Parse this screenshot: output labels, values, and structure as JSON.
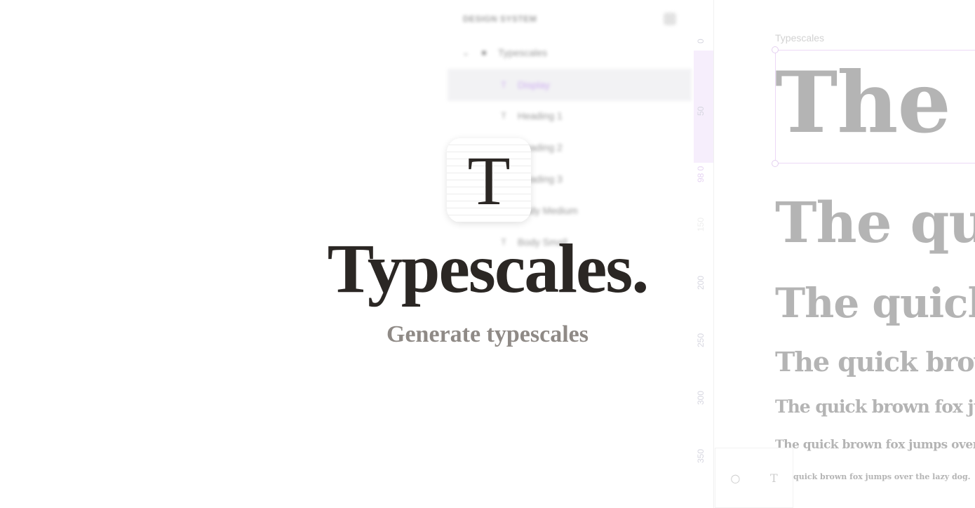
{
  "sidebar": {
    "title": "DESIGN SYSTEM",
    "items": [
      {
        "label": "Typescales",
        "icon": "frame-icon"
      },
      {
        "label": "Display",
        "icon": "text-icon",
        "selected": true
      },
      {
        "label": "Heading 1",
        "icon": "text-icon"
      },
      {
        "label": "Heading 2",
        "icon": "text-icon"
      },
      {
        "label": "Heading 3",
        "icon": "text-icon"
      },
      {
        "label": "Body Medium",
        "icon": "text-icon"
      },
      {
        "label": "Body Small",
        "icon": "text-icon"
      }
    ]
  },
  "ruler": {
    "ticks": [
      "0",
      "50",
      "98 0",
      "150",
      "200",
      "250",
      "300",
      "350"
    ]
  },
  "canvas": {
    "label": "Typescales",
    "samples": [
      "The quick brown fox jumps over the lazy dog.",
      "The quick brown fox jumps over the lazy dog.",
      "The quick brown fox jumps over the lazy dog.",
      "The quick brown fox jumps over the lazy dog.",
      "The quick brown fox jumps over the lazy dog.",
      "The quick brown fox jumps over the lazy dog.",
      "quick brown fox jumps over the lazy dog."
    ]
  },
  "toolbar": {
    "fill_icon": "droplet-icon",
    "text_icon": "text-icon",
    "fill_glyph": "○",
    "text_glyph": "T"
  },
  "hero": {
    "icon_letter": "T",
    "title": "Typescales.",
    "subtitle": "Generate typescales"
  },
  "colors": {
    "accent": "#a46ae8",
    "text": "#2b2724",
    "subtitle": "#8f8a86"
  }
}
